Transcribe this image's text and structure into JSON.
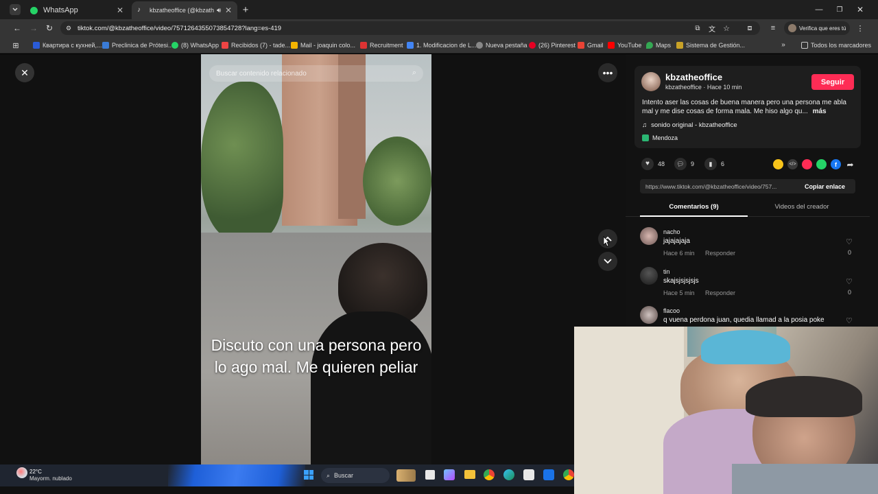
{
  "tabs": [
    {
      "label": "WhatsApp"
    },
    {
      "label": "kbzatheoffice (@kbzatheoff"
    }
  ],
  "url": "tiktok.com/@kbzatheoffice/video/7571264355073854728?lang=es-419",
  "verify_label": "Verifica que eres tú",
  "bookmarks": [
    {
      "label": "Квартира с кухней,...",
      "color": "#2a5bd7"
    },
    {
      "label": "Preclinica de Prótesi...",
      "color": "#3a7bd5"
    },
    {
      "label": "(8) WhatsApp",
      "color": "#25d366"
    },
    {
      "label": "Recibidos (7) - tade...",
      "color": "#e44"
    },
    {
      "label": "Mail - joaquin colo...",
      "color": "#f4b400"
    },
    {
      "label": "Recruitment",
      "color": "#d33"
    },
    {
      "label": "1. Modificacion de L...",
      "color": "#4285f4"
    },
    {
      "label": "Nueva pestaña",
      "color": "#888"
    },
    {
      "label": "(26) Pinterest",
      "color": "#e60023"
    },
    {
      "label": "Gmail",
      "color": "#ea4335"
    },
    {
      "label": "YouTube",
      "color": "#ff0000"
    },
    {
      "label": "Maps",
      "color": "#34a853"
    },
    {
      "label": "Sistema de Gestión...",
      "color": "#c9a227"
    }
  ],
  "bookmarks_all": "Todos los marcadores",
  "search_placeholder": "Buscar contenido relacionado",
  "caption_overlay": "Discuto con una persona pero lo ago mal. Me quieren peliar",
  "author": {
    "name": "kbzatheoffice",
    "sub": "kbzatheoffice · Hace 10 min",
    "follow": "Seguir"
  },
  "description": "Intento aser las cosas de buena manera pero una persona me abla mal y me dise cosas de forma mala. Me hiso algo qu...",
  "more": "más",
  "sound": "sonido original - kbzatheoffice",
  "location": "Mendoza",
  "stats": {
    "likes": "48",
    "comments": "9",
    "saves": "6"
  },
  "share_url": "https://www.tiktok.com/@kbzatheoffice/video/757...",
  "copy_link": "Copiar enlace",
  "panel_tabs": {
    "comments": "Comentarios (9)",
    "videos": "Videos del creador"
  },
  "comments": [
    {
      "user": "nacho",
      "text": "jajajajaja",
      "time": "Hace 6 min",
      "reply": "Responder",
      "likes": "0"
    },
    {
      "user": "tin",
      "text": "skajsjsjsjsjs",
      "time": "Hace 5 min",
      "reply": "Responder",
      "likes": "0"
    },
    {
      "user": "flacoo",
      "text": "q vuena perdona juan, quedia llamad a la posia poke",
      "time": "",
      "reply": "",
      "likes": ""
    }
  ],
  "weather": {
    "temp": "22°C",
    "desc": "Mayorm. nublado"
  },
  "taskbar_search": "Buscar",
  "colors": {
    "accent": "#fe2c55",
    "background": "#121212"
  }
}
